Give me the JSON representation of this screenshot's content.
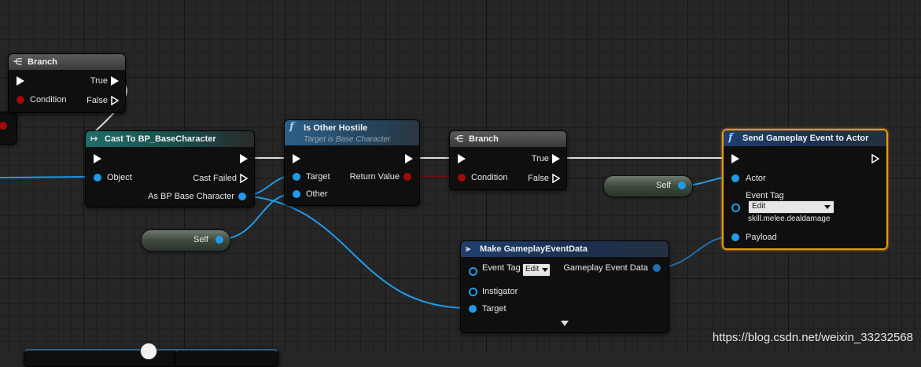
{
  "nodes": {
    "branch_top": {
      "title": "Branch",
      "true_label": "True",
      "false_label": "False",
      "condition_label": "Condition"
    },
    "cast": {
      "title": "Cast To BP_BaseCharacter",
      "object_label": "Object",
      "cast_failed_label": "Cast Failed",
      "as_label": "As BP Base Character"
    },
    "hostile": {
      "title": "Is Other Hostile",
      "subtitle": "Target is Base Character",
      "target_label": "Target",
      "other_label": "Other",
      "return_label": "Return Value"
    },
    "branch_mid": {
      "title": "Branch",
      "true_label": "True",
      "false_label": "False",
      "condition_label": "Condition"
    },
    "send_event": {
      "title": "Send Gameplay Event to Actor",
      "actor_label": "Actor",
      "event_tag_label": "Event Tag",
      "edit_label": "Edit",
      "tag_value": "skill.melee.dealdamage",
      "payload_label": "Payload"
    },
    "make_data": {
      "title": "Make GameplayEventData",
      "event_tag_label": "Event Tag",
      "edit_label": "Edit",
      "instigator_label": "Instigator",
      "target_label": "Target",
      "output_label": "Gameplay Event Data"
    },
    "self_right": {
      "label": "Self"
    },
    "self_left": {
      "label": "Self"
    }
  },
  "watermark": "https://blog.csdn.net/weixin_33232568"
}
